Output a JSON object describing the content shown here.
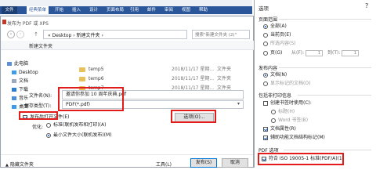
{
  "ribbon": {
    "file_tab": "文件",
    "classic_tab": "经典菜单",
    "tabs": [
      "开始",
      "插入",
      "设计",
      "页面布局",
      "引用",
      "邮件",
      "审阅",
      "视图",
      "帮助"
    ]
  },
  "save_dialog": {
    "title": "发布为 PDF 或 XPS",
    "address_path": "« Desktop  ›  新建文件夹  ›",
    "search_placeholder": "搜索\"新建文件夹 (2)\"",
    "toolbar_new_folder": "新建文件夹",
    "tree": [
      {
        "label": "此电脑",
        "icon": "computer-icon"
      },
      {
        "label": "Desktop",
        "icon": "desktop-icon"
      },
      {
        "label": "文档",
        "icon": "documents-icon"
      },
      {
        "label": "下载",
        "icon": "downloads-icon"
      },
      {
        "label": "音乐",
        "icon": "music-icon"
      },
      {
        "label": "桌面",
        "icon": "desktop-icon"
      }
    ],
    "files": [
      {
        "name": "temp5",
        "date": "2018/11/17 星期...",
        "type": "文件夹"
      },
      {
        "name": "temp6",
        "date": "2018/11/17 星期...",
        "type": "文件夹"
      },
      {
        "name": "temp7",
        "date": "2018/11/17 星期...",
        "type": "文件夹"
      }
    ],
    "filename_label": "文件名(N):",
    "filename_value": "邀请你参加 10 周年庆典.pdf",
    "filetype_label": "保存类型(T):",
    "filetype_value": "PDF(*.pdf)",
    "open_after_publish": "发布后打开文件(E)",
    "optimize_label": "优化:",
    "optimize_standard": "标准(联机发布和打印)(A)",
    "optimize_minimum": "最小文件大小(联机发布)(M)",
    "options_button": "选项(O)...",
    "hide_folders": "隐藏文件夹",
    "tools_button": "工具(L)",
    "publish_button": "发布(S)",
    "cancel_button": "取消"
  },
  "options_dialog": {
    "title": "选项",
    "close": "?",
    "page_range_header": "页面范围",
    "all": "全部(A)",
    "current_page": "当前页(E)",
    "selection": "所选内容(S)",
    "pages": "页(G)",
    "from_label": "从(F):",
    "from_value": "1",
    "to_label": "到(T):",
    "to_value": "1",
    "publish_header": "发布内容",
    "publish_document": "文档(N)",
    "publish_markup": "显示标记的文档(O)",
    "include_header": "包括非打印信息",
    "create_bookmarks": "创建书签时使用(C):",
    "bookmark_headings": "标题(H)",
    "bookmark_word": "Word 书签(B)",
    "doc_properties": "文档属性(R)",
    "accessibility_tags": "辅助功能文档结构标记(M)",
    "pdf_header": "PDF 选项",
    "iso_compliant": "符合 ISO 19005-1 标准(PDF/A)(1)"
  },
  "colors": {
    "highlight": "#e21b1b",
    "ribbon_blue": "#2b579a",
    "accent": "#1a63c6"
  }
}
